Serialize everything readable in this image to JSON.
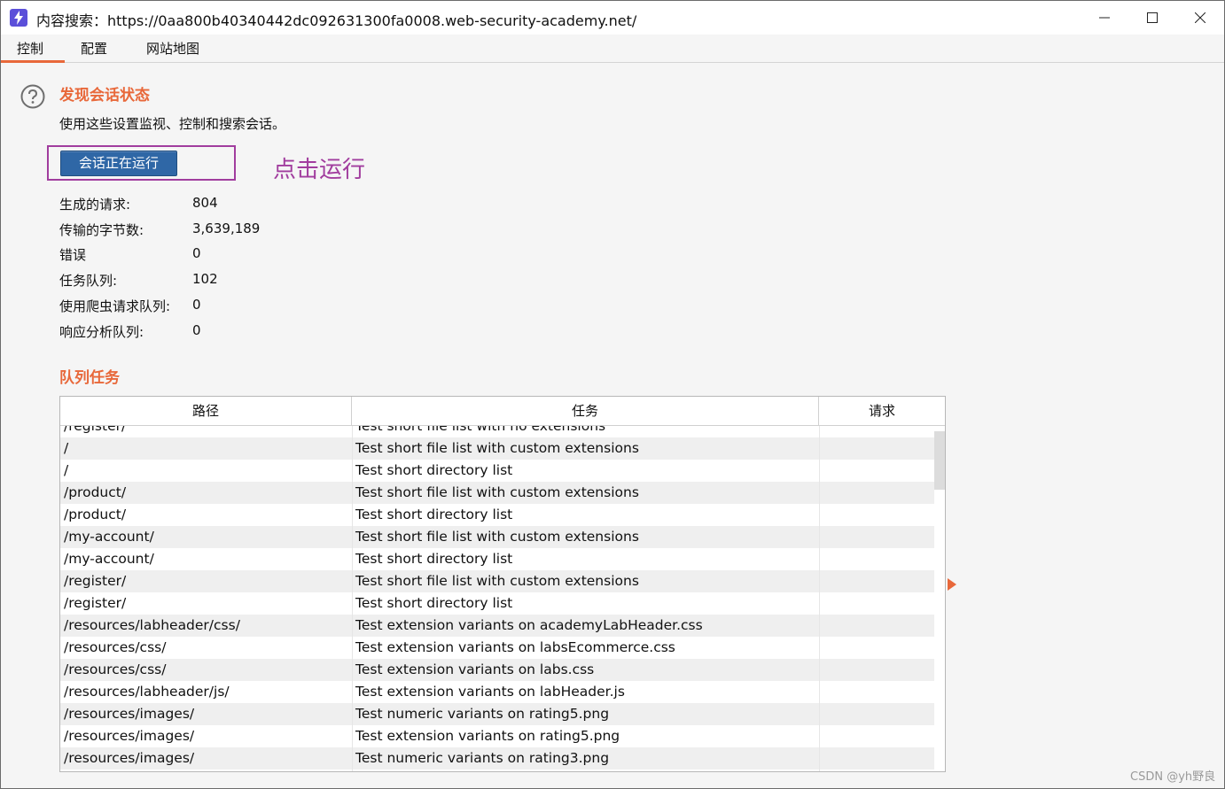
{
  "window": {
    "title": "内容搜索：https://0aa800b40340442dc092631300fa0008.web-security-academy.net/",
    "controls": [
      "minimize-icon",
      "maximize-icon",
      "close-icon"
    ]
  },
  "tabs": [
    {
      "label": "控制",
      "active": true
    },
    {
      "label": "配置",
      "active": false
    },
    {
      "label": "网站地图",
      "active": false
    }
  ],
  "session": {
    "title": "发现会话状态",
    "description": "使用这些设置监视、控制和搜索会话。",
    "run_button_label": "会话正在运行",
    "annotation": "点击运行"
  },
  "stats": [
    {
      "label": "生成的请求:",
      "value": "804"
    },
    {
      "label": "传输的字节数:",
      "value": "3,639,189"
    },
    {
      "label": "错误",
      "value": "0"
    },
    {
      "label": "任务队列:",
      "value": "102"
    },
    {
      "label": "使用爬虫请求队列:",
      "value": "0"
    },
    {
      "label": "响应分析队列:",
      "value": "0"
    }
  ],
  "queue": {
    "title": "队列任务",
    "columns": [
      "路径",
      "任务",
      "请求"
    ],
    "rows": [
      {
        "path": "/register/",
        "task": "Test short file list with no extensions",
        "requests": ""
      },
      {
        "path": "/",
        "task": "Test short file list with custom extensions",
        "requests": ""
      },
      {
        "path": "/",
        "task": "Test short directory list",
        "requests": ""
      },
      {
        "path": "/product/",
        "task": "Test short file list with custom extensions",
        "requests": ""
      },
      {
        "path": "/product/",
        "task": "Test short directory list",
        "requests": ""
      },
      {
        "path": "/my-account/",
        "task": "Test short file list with custom extensions",
        "requests": ""
      },
      {
        "path": "/my-account/",
        "task": "Test short directory list",
        "requests": ""
      },
      {
        "path": "/register/",
        "task": "Test short file list with custom extensions",
        "requests": ""
      },
      {
        "path": "/register/",
        "task": "Test short directory list",
        "requests": ""
      },
      {
        "path": "/resources/labheader/css/",
        "task": "Test extension variants on academyLabHeader.css",
        "requests": ""
      },
      {
        "path": "/resources/css/",
        "task": "Test extension variants on labsEcommerce.css",
        "requests": ""
      },
      {
        "path": "/resources/css/",
        "task": "Test extension variants on labs.css",
        "requests": ""
      },
      {
        "path": "/resources/labheader/js/",
        "task": "Test extension variants on labHeader.js",
        "requests": ""
      },
      {
        "path": "/resources/images/",
        "task": "Test numeric variants on rating5.png",
        "requests": ""
      },
      {
        "path": "/resources/images/",
        "task": "Test extension variants on rating5.png",
        "requests": ""
      },
      {
        "path": "/resources/images/",
        "task": "Test numeric variants on rating3.png",
        "requests": ""
      }
    ]
  },
  "watermark": "CSDN @yh野良",
  "colors": {
    "accent": "#e8683a",
    "button": "#2f67a6",
    "annotation": "#a13d9e",
    "app_icon": "#5b4fd9"
  }
}
